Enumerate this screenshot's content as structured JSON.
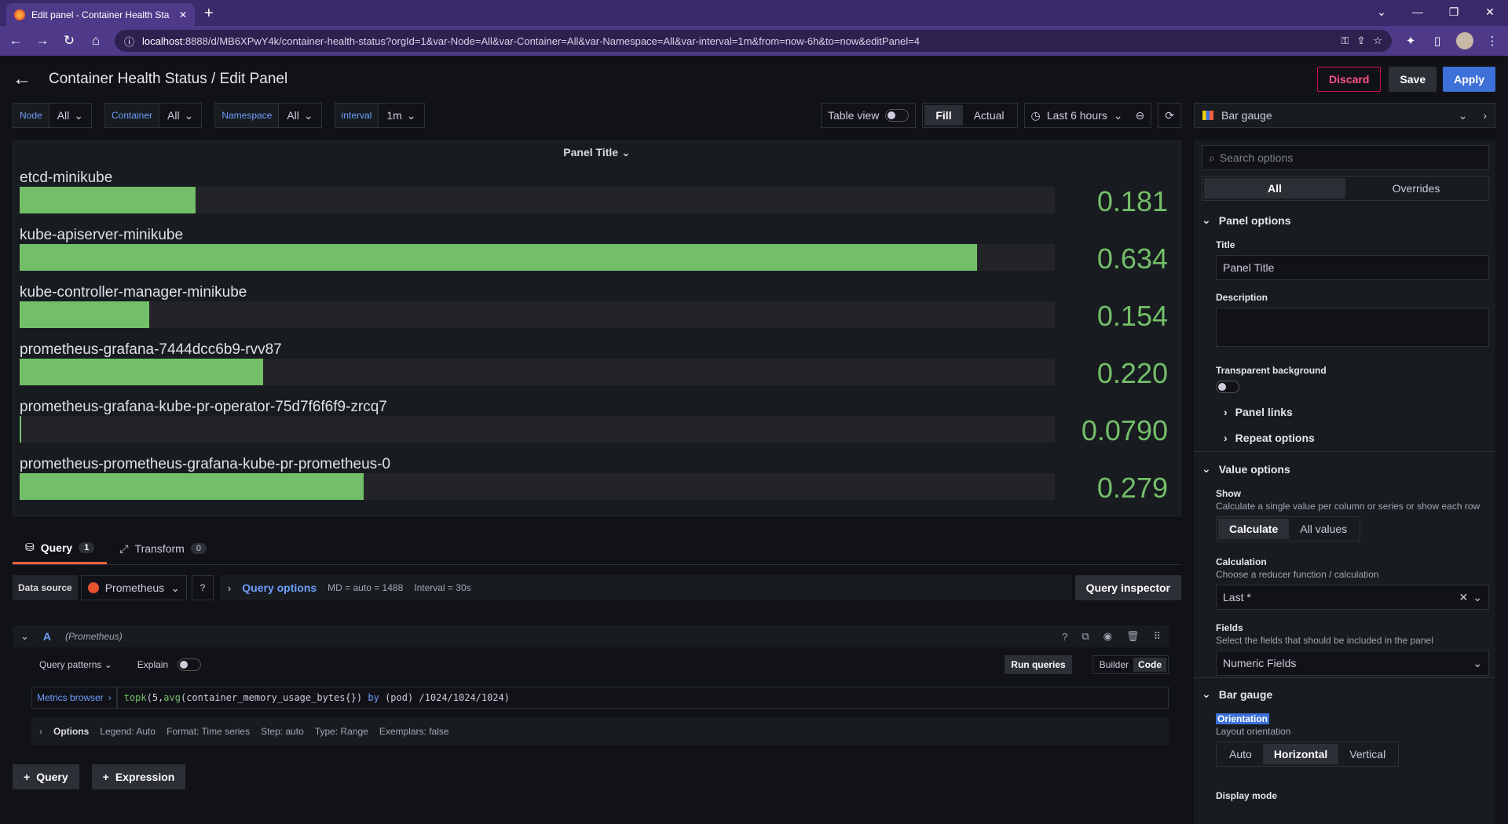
{
  "browser": {
    "tab_title": "Edit panel - Container Health Sta",
    "url_host": "localhost",
    "url_rest": ":8888/d/MB6XPwY4k/container-health-status?orgId=1&var-Node=All&var-Container=All&var-Namespace=All&var-interval=1m&from=now-6h&to=now&editPanel=4"
  },
  "header": {
    "title": "Container Health Status / Edit Panel",
    "discard": "Discard",
    "save": "Save",
    "apply": "Apply"
  },
  "variables": [
    {
      "label": "Node",
      "value": "All"
    },
    {
      "label": "Container",
      "value": "All"
    },
    {
      "label": "Namespace",
      "value": "All"
    },
    {
      "label": "interval",
      "value": "1m"
    }
  ],
  "toolbar": {
    "table_view": "Table view",
    "fill": "Fill",
    "actual": "Actual",
    "time_range": "Last 6 hours"
  },
  "panel": {
    "title": "Panel Title"
  },
  "chart_data": {
    "type": "bar",
    "orientation": "horizontal",
    "title": "Panel Title",
    "categories": [
      "etcd-minikube",
      "kube-apiserver-minikube",
      "kube-controller-manager-minikube",
      "prometheus-grafana-7444dcc6b9-rvv87",
      "prometheus-grafana-kube-pr-operator-75d7f6f6f9-zrcq7",
      "prometheus-prometheus-grafana-kube-pr-prometheus-0"
    ],
    "values": [
      0.181,
      0.634,
      0.154,
      0.22,
      0.079,
      0.279
    ],
    "value_labels": [
      "0.181",
      "0.634",
      "0.154",
      "0.220",
      "0.0790",
      "0.279"
    ],
    "fill_fraction": [
      0.17,
      0.925,
      0.125,
      0.235,
      0.0,
      0.332
    ],
    "color": "#73bf69"
  },
  "query_tabs": {
    "query": "Query",
    "query_count": "1",
    "transform": "Transform",
    "transform_count": "0"
  },
  "datasource": {
    "label": "Data source",
    "name": "Prometheus",
    "options_label": "Query options",
    "md": "MD = auto = 1488",
    "interval": "Interval = 30s",
    "inspector": "Query inspector"
  },
  "query": {
    "ref_id": "A",
    "ds": "(Prometheus)",
    "patterns": "Query patterns",
    "explain": "Explain",
    "run": "Run queries",
    "builder": "Builder",
    "code": "Code",
    "metrics_browser": "Metrics browser",
    "expr_fn1": "topk",
    "expr_p1": "(5,",
    "expr_fn2": "avg",
    "expr_p2": "(container_memory_usage_bytes{}) ",
    "expr_kw": "by",
    "expr_p3": " (pod) /1024/1024/1024)",
    "options_label": "Options",
    "legend": "Legend: Auto",
    "format": "Format: Time series",
    "step": "Step: auto",
    "qtype": "Type: Range",
    "exemplars": "Exemplars: false"
  },
  "add": {
    "query": "Query",
    "expression": "Expression"
  },
  "options": {
    "viz": "Bar gauge",
    "search_placeholder": "Search options",
    "all": "All",
    "overrides": "Overrides",
    "panel_options": "Panel options",
    "title_label": "Title",
    "title_value": "Panel Title",
    "description_label": "Description",
    "transparent_label": "Transparent background",
    "panel_links": "Panel links",
    "repeat_options": "Repeat options",
    "value_options": "Value options",
    "show_label": "Show",
    "show_desc": "Calculate a single value per column or series or show each row",
    "calculate": "Calculate",
    "all_values": "All values",
    "calc_label": "Calculation",
    "calc_desc": "Choose a reducer function / calculation",
    "calc_value": "Last *",
    "fields_label": "Fields",
    "fields_desc": "Select the fields that should be included in the panel",
    "fields_value": "Numeric Fields",
    "bar_gauge": "Bar gauge",
    "orientation_label": "Orientation",
    "orientation_desc": "Layout orientation",
    "auto": "Auto",
    "horizontal": "Horizontal",
    "vertical": "Vertical",
    "display_mode": "Display mode"
  }
}
